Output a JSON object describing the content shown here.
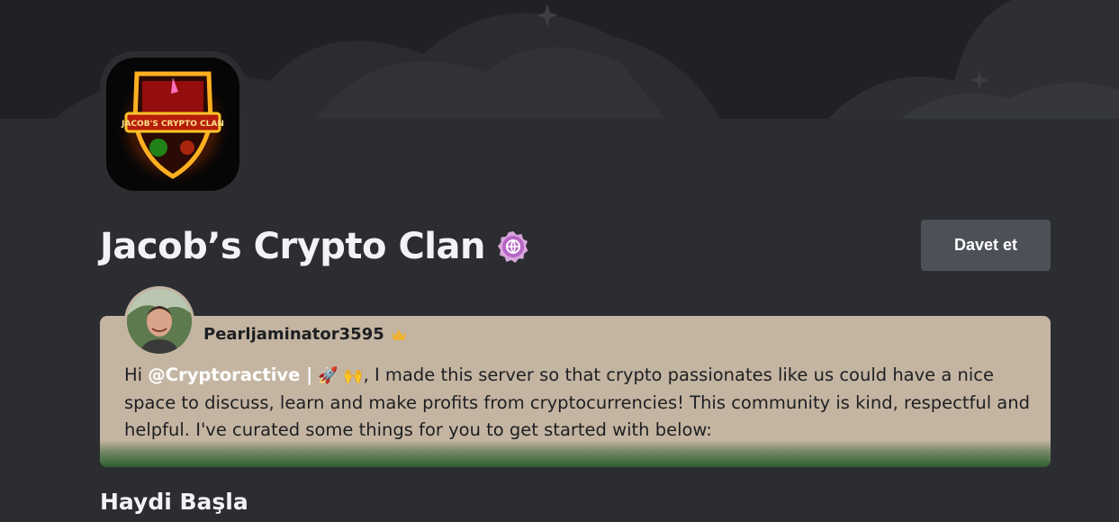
{
  "server": {
    "name": "Jacob’s Crypto Clan",
    "icon_name": "crypto-clan-shield-logo",
    "icon_text": "JACOB'S CRYPTO CLAN",
    "badge": "discoverable-verified-icon"
  },
  "actions": {
    "invite_label": "Davet et"
  },
  "welcome": {
    "author": "Pearljaminator3595",
    "author_badge": "owner-crown-icon",
    "greeting": "Hi ",
    "mention": "@Cryptoractive |",
    "emojis": " 🚀 🙌",
    "body": ", I made this server so that crypto passionates like us could have a nice space to discuss, learn and make profits from cryptocurrencies! This community is kind, respectful and helpful. I've curated some things for you to get started with below:"
  },
  "sections": {
    "get_started_title": "Haydi Başla"
  },
  "colors": {
    "background": "#2b2d31",
    "banner": "#202124",
    "card": "#c4b5a2",
    "button": "#4e5058",
    "badge": "#c16fc9"
  }
}
